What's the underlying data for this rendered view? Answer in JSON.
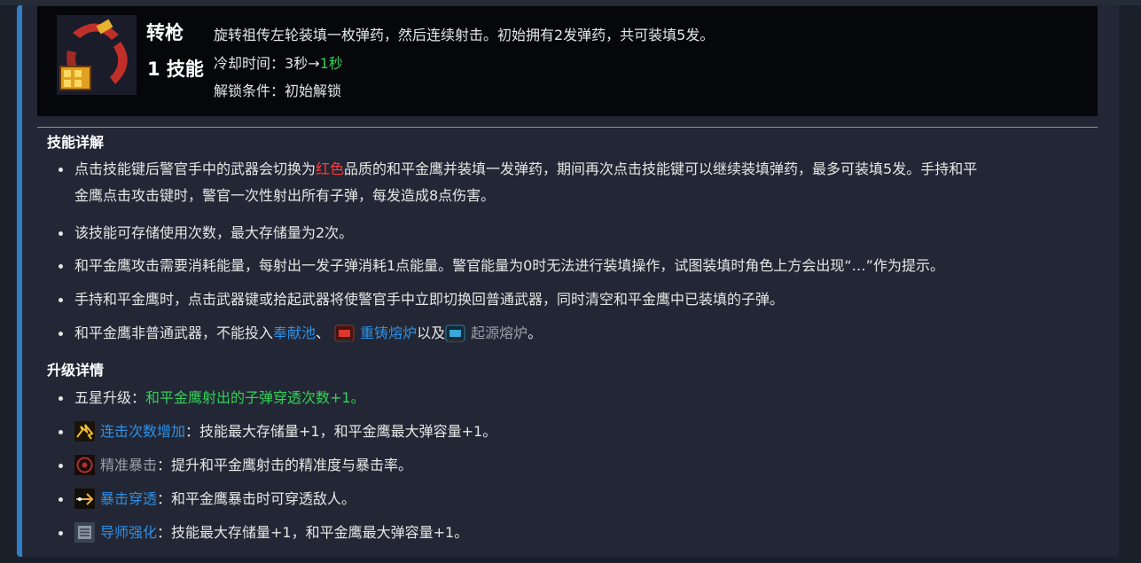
{
  "skill": {
    "name": "转枪",
    "type": "1 技能",
    "description": "旋转祖传左轮装填一枚弹药，然后连续射击。初始拥有2发弹药，共可装填5发。",
    "cooldown_label": "冷却时间：",
    "cooldown_from": "3秒",
    "cooldown_arrow": "→",
    "cooldown_to": "1秒",
    "unlock_label": "解锁条件：",
    "unlock_value": "初始解锁"
  },
  "details": {
    "title": "技能详解",
    "b1_part1": "点击技能键后警官手中的武器会切换为",
    "b1_red": "红色",
    "b1_part2": "品质的和平金鹰并装填一发弹药，期间再次点击技能键可以继续装填弹药，最多可装填5发。手持和平",
    "b1_line2": "金鹰点击攻击键时，警官一次性射出所有子弹，每发造成8点伤害。",
    "b2": "该技能可存储使用次数，最大存储量为2次。",
    "b3": "和平金鹰攻击需要消耗能量，每射出一发子弹消耗1点能量。警官能量为0时无法进行装填操作，试图装填时角色上方会出现“…”作为提示。",
    "b4": "手持和平金鹰时，点击武器键或拾起武器将使警官手中立即切换回普通武器，同时清空和平金鹰中已装填的子弹。",
    "b5_part1": "和平金鹰非普通武器，不能投入",
    "b5_link1": "奉献池",
    "b5_sep": "、",
    "b5_link2": "重铸熔炉",
    "b5_mid": "以及",
    "b5_link3": "起源熔炉",
    "b5_end": "。"
  },
  "upgrades": {
    "title": "升级详情",
    "u1_label": "五星升级：",
    "u1_value": "和平金鹰射出的子弹穿透次数+1。",
    "u2_link": "连击次数增加",
    "u2_text": "：技能最大存储量+1，和平金鹰最大弹容量+1。",
    "u3_link": "精准暴击",
    "u3_text": "：提升和平金鹰射击的精准度与暴击率。",
    "u4_link": "暴击穿透",
    "u4_text": "：和平金鹰暴击时可穿透敌人。",
    "u5_link": "导师强化",
    "u5_text": "：技能最大存储量+1，和平金鹰最大弹容量+1。"
  },
  "colors": {
    "accent_bar": "#2f7fc7",
    "link": "#2e8fe6",
    "green": "#34d058",
    "red": "#ff3b3b",
    "muted_link": "#9a9fa8"
  },
  "icons": [
    "revolver-spin-skill-icon",
    "forge-icon",
    "origin-forge-icon",
    "combo-icon",
    "crosshair-icon",
    "pierce-icon",
    "mentor-icon"
  ]
}
